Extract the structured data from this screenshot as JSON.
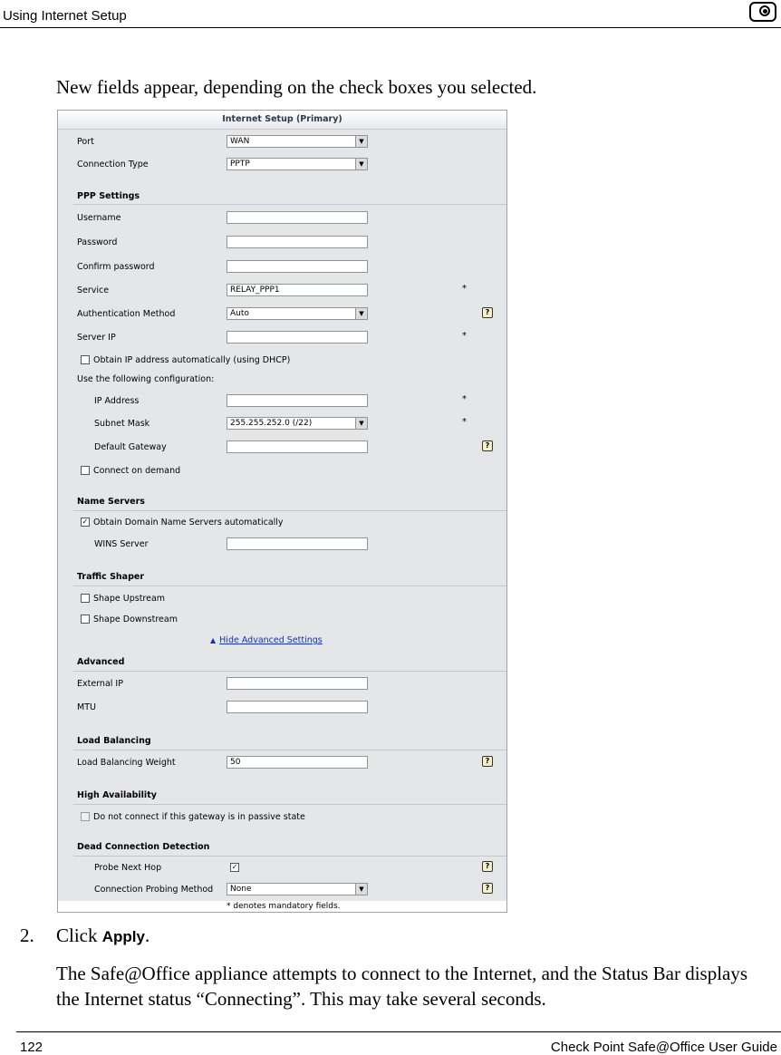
{
  "header": {
    "title": "Using Internet Setup",
    "logo": "check-point-logo"
  },
  "intro": "New fields appear, depending on the check boxes you selected.",
  "panel": {
    "title": "Internet Setup (Primary)",
    "port": {
      "label": "Port",
      "value": "WAN"
    },
    "connection_type": {
      "label": "Connection Type",
      "value": "PPTP"
    },
    "ppp_settings": {
      "heading": "PPP Settings",
      "username": {
        "label": "Username",
        "value": ""
      },
      "password": {
        "label": "Password",
        "value": ""
      },
      "confirm_password": {
        "label": "Confirm password",
        "value": ""
      },
      "service": {
        "label": "Service",
        "value": "RELAY_PPP1"
      },
      "auth_method": {
        "label": "Authentication Method",
        "value": "Auto"
      },
      "server_ip": {
        "label": "Server IP",
        "value": ""
      },
      "obtain_ip": {
        "label": "Obtain IP address automatically (using DHCP)",
        "checked": false
      },
      "use_following": "Use the following configuration:",
      "ip_address": {
        "label": "IP Address",
        "value": ""
      },
      "subnet_mask": {
        "label": "Subnet Mask",
        "value": "255.255.252.0 (/22)"
      },
      "default_gateway": {
        "label": "Default Gateway",
        "value": ""
      },
      "connect_on_demand": {
        "label": "Connect on demand",
        "checked": false
      }
    },
    "name_servers": {
      "heading": "Name Servers",
      "obtain_dns": {
        "label": "Obtain Domain Name Servers automatically",
        "checked": true
      },
      "wins_server": {
        "label": "WINS Server",
        "value": ""
      }
    },
    "traffic_shaper": {
      "heading": "Traffic Shaper",
      "shape_upstream": {
        "label": "Shape Upstream",
        "checked": false
      },
      "shape_downstream": {
        "label": "Shape Downstream",
        "checked": false
      }
    },
    "hide_advanced": "Hide Advanced Settings",
    "advanced": {
      "heading": "Advanced",
      "external_ip": {
        "label": "External IP",
        "value": ""
      },
      "mtu": {
        "label": "MTU",
        "value": ""
      }
    },
    "load_balancing": {
      "heading": "Load Balancing",
      "weight": {
        "label": "Load Balancing Weight",
        "value": "50"
      }
    },
    "high_availability": {
      "heading": "High Availability",
      "do_not_connect": {
        "label": "Do not connect if this gateway is in passive state",
        "checked": false
      }
    },
    "dead_connection": {
      "heading": "Dead Connection Detection",
      "probe_next_hop": {
        "label": "Probe Next Hop",
        "checked": true
      },
      "probing_method": {
        "label": "Connection Probing Method",
        "value": "None"
      }
    },
    "mandatory_note": "* denotes mandatory fields.",
    "asterisk": "*",
    "help": "?",
    "check_mark": "✓",
    "dropdown_arrow": "▼",
    "link_arrow": "▲"
  },
  "step": {
    "number": "2.",
    "click": "Click",
    "apply": "Apply",
    "period": ".",
    "description": "The Safe@Office appliance attempts to connect to the Internet, and the Status Bar displays the Internet status “Connecting”. This may take several seconds."
  },
  "footer": {
    "page_number": "122",
    "guide_title": "Check Point Safe@Office User Guide"
  }
}
